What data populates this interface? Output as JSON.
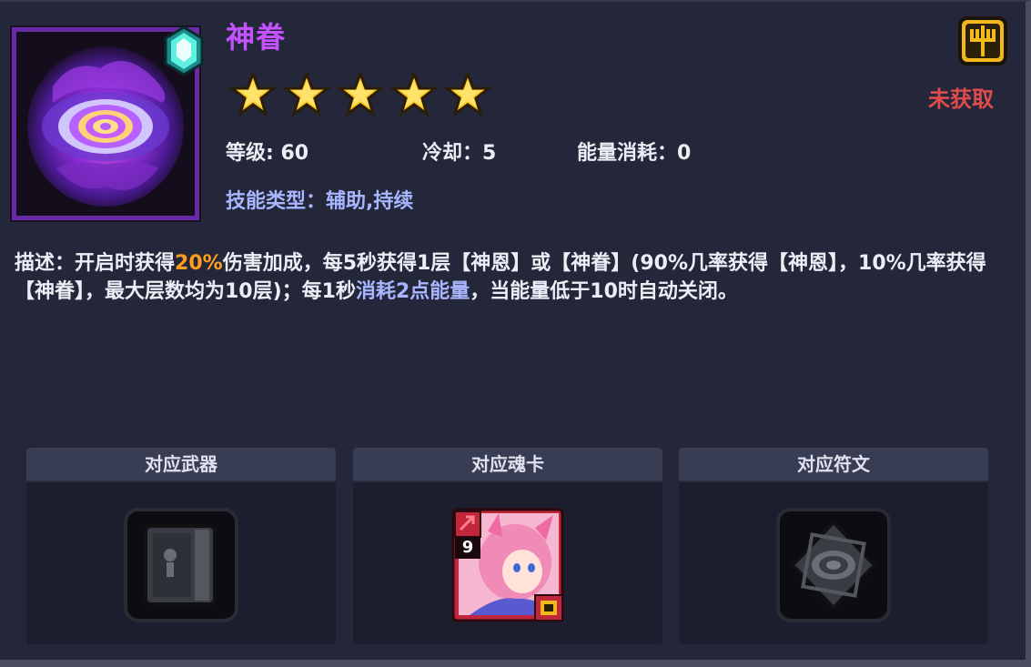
{
  "skill": {
    "name": "神眷",
    "stars": 5,
    "level_label": "等级: 60",
    "cooldown_label": "冷却：5",
    "energy_label": "能量消耗：0",
    "type_label": "技能类型：辅助,持续",
    "status": "未获取"
  },
  "description": {
    "prefix": "描述：开启时获得",
    "bonus": "20%",
    "part1": "伤害加成，每5秒获得1层【神恩】或【神眷】(90%几率获得【神恩】，10%几率获得【神眷】，最大层数均为10层)；每1秒",
    "cost": "消耗2点能量",
    "part2": "，当能量低于10时自动关闭。"
  },
  "slots": [
    {
      "title": "对应武器",
      "item": "weapon-book-icon"
    },
    {
      "title": "对应魂卡",
      "item": "soul-card",
      "card_level": "9"
    },
    {
      "title": "对应符文",
      "item": "rune-diamond-icon"
    }
  ],
  "colors": {
    "title": "#c552ff",
    "status": "#e04c4c",
    "highlight_orange": "#ff9d1e",
    "highlight_blue": "#a8b6ff"
  }
}
